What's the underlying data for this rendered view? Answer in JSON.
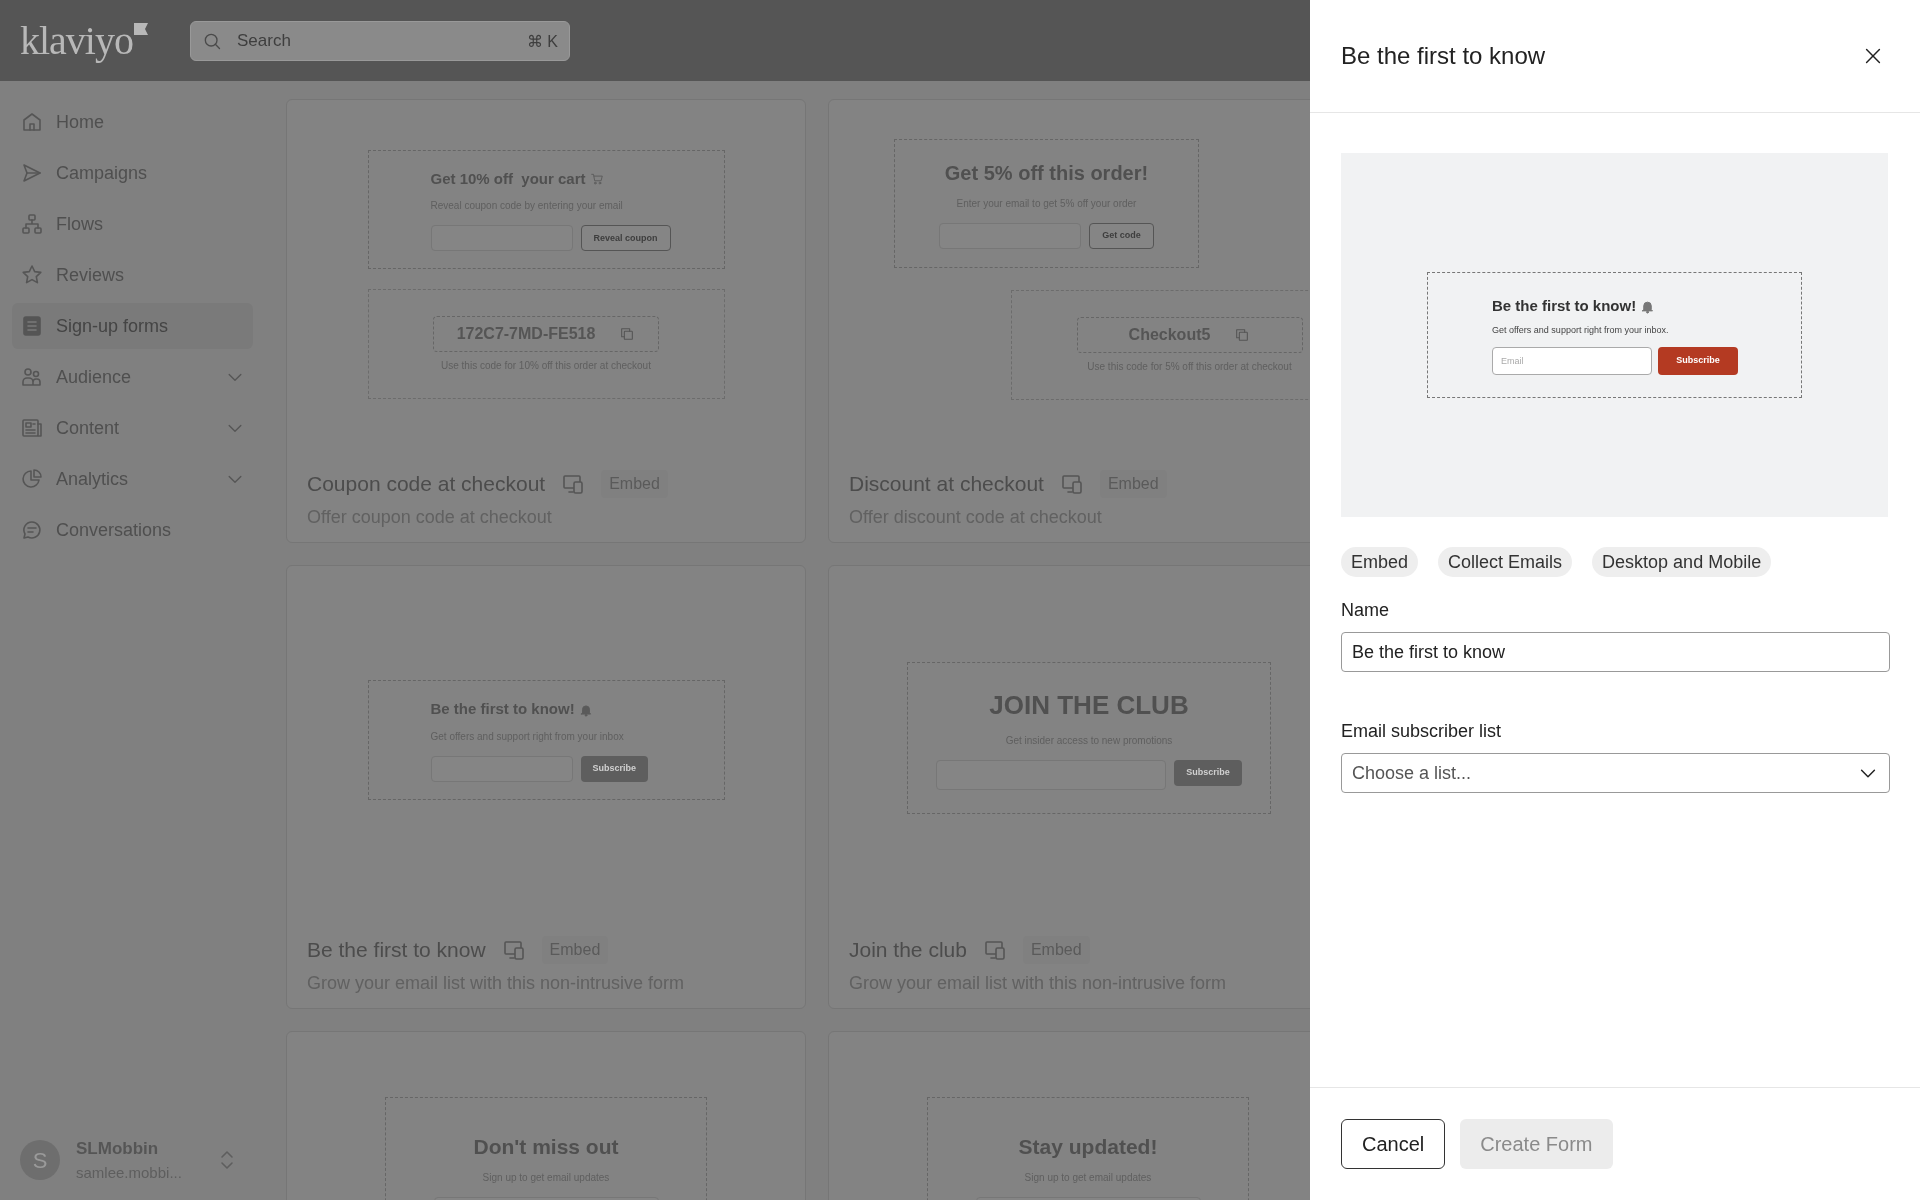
{
  "topbar": {
    "logo": "klaviyo",
    "search": {
      "placeholder": "Search",
      "shortcut": "⌘ K"
    }
  },
  "sidebar": {
    "items": [
      {
        "label": "Home",
        "selected": false,
        "expandable": false
      },
      {
        "label": "Campaigns",
        "selected": false,
        "expandable": false
      },
      {
        "label": "Flows",
        "selected": false,
        "expandable": false
      },
      {
        "label": "Reviews",
        "selected": false,
        "expandable": false
      },
      {
        "label": "Sign-up forms",
        "selected": true,
        "expandable": false
      },
      {
        "label": "Audience",
        "selected": false,
        "expandable": true
      },
      {
        "label": "Content",
        "selected": false,
        "expandable": true
      },
      {
        "label": "Analytics",
        "selected": false,
        "expandable": true
      },
      {
        "label": "Conversations",
        "selected": false,
        "expandable": false
      }
    ],
    "account": {
      "initial": "S",
      "name": "SLMobbin",
      "email": "samlee.mobbi..."
    }
  },
  "templates": [
    {
      "title": "Coupon code at checkout",
      "tag": "Embed",
      "description": "Offer coupon code at checkout",
      "preview": {
        "kind": "coupon",
        "heading": "Get 10% off  your cart",
        "subtitle": "Reveal coupon code by entering your email",
        "button": "Reveal coupon",
        "code": "172C7-7MD-FE518",
        "code_note": "Use this code for 10% off this order at checkout"
      }
    },
    {
      "title": "Discount at checkout",
      "tag": "Embed",
      "description": "Offer discount code at checkout",
      "preview": {
        "kind": "discount",
        "heading": "Get 5% off this order!",
        "subtitle": "Enter your email to get 5% off your order",
        "button": "Get code",
        "code": "Checkout5",
        "code_note": "Use this code for 5% off this order at checkout"
      }
    },
    {
      "title": "Be the first to know",
      "tag": "Embed",
      "description": "Grow your email list with this non-intrusive form",
      "preview": {
        "kind": "subscribe",
        "heading": "Be the first to know!",
        "subtitle": "Get offers and support right from your inbox",
        "button": "Subscribe"
      }
    },
    {
      "title": "Join the club",
      "tag": "Embed",
      "description": "Grow your email list with this non-intrusive form",
      "preview": {
        "kind": "club",
        "heading": "JOIN THE CLUB",
        "subtitle": "Get insider access to new promotions",
        "button": "Subscribe"
      }
    },
    {
      "preview": {
        "kind": "partial",
        "heading": "Don't miss out",
        "subtitle": "Sign up to get email updates"
      }
    },
    {
      "preview": {
        "kind": "partial",
        "heading": "Stay updated!",
        "subtitle": "Sign up to get email updates"
      }
    }
  ],
  "drawer": {
    "title": "Be the first to know",
    "preview": {
      "heading": "Be the first to know!",
      "subtitle": "Get offers and support right from your inbox.",
      "placeholder": "Email",
      "button": "Subscribe"
    },
    "tags": [
      "Embed",
      "Collect Emails",
      "Desktop and Mobile"
    ],
    "name_field": {
      "label": "Name",
      "value": "Be the first to know"
    },
    "list_field": {
      "label": "Email subscriber list",
      "placeholder": "Choose a list..."
    },
    "buttons": [
      {
        "label": "Cancel",
        "kind": "secondary"
      },
      {
        "label": "Create Form",
        "kind": "primary"
      }
    ]
  }
}
